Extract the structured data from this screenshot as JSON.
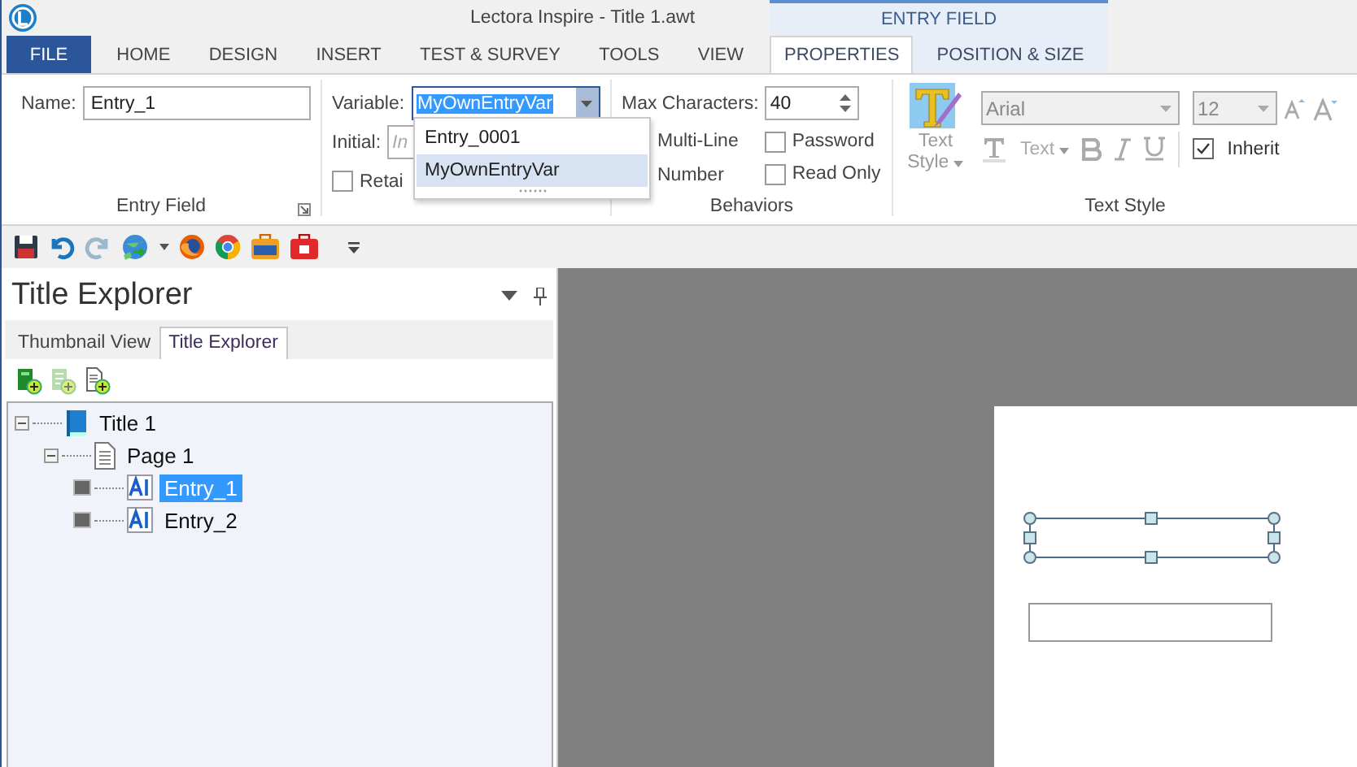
{
  "window": {
    "title": "Lectora Inspire - Title 1.awt",
    "context_group": "ENTRY FIELD"
  },
  "tabs": [
    {
      "label": "FILE",
      "kind": "file",
      "selected": false
    },
    {
      "label": "HOME",
      "kind": "normal",
      "selected": false
    },
    {
      "label": "DESIGN",
      "kind": "normal",
      "selected": false
    },
    {
      "label": "INSERT",
      "kind": "normal",
      "selected": false
    },
    {
      "label": "TEST & SURVEY",
      "kind": "normal",
      "selected": false
    },
    {
      "label": "TOOLS",
      "kind": "normal",
      "selected": false
    },
    {
      "label": "VIEW",
      "kind": "normal",
      "selected": false
    },
    {
      "label": "PROPERTIES",
      "kind": "context",
      "selected": true
    },
    {
      "label": "POSITION & SIZE",
      "kind": "context",
      "selected": false
    }
  ],
  "entry_field_group": {
    "name_label": "Name:",
    "name_value": "Entry_1",
    "group_label": "Entry Field"
  },
  "value_group": {
    "variable_label": "Variable:",
    "variable_value": "MyOwnEntryVar",
    "initial_label": "Initial:",
    "initial_placeholder": "In",
    "retain": {
      "label": "Retai",
      "checked": false
    },
    "variable_options": [
      {
        "label": "Entry_0001",
        "selected": false
      },
      {
        "label": "MyOwnEntryVar",
        "selected": true
      }
    ]
  },
  "behaviors_group": {
    "max_label": "Max Characters:",
    "max_value": "40",
    "multi_line_label": "Multi-Line",
    "number_label": "Number",
    "group_label": "Behaviors",
    "checkboxes": [
      {
        "label": "Password",
        "checked": false
      },
      {
        "label": "Read Only",
        "checked": false
      }
    ]
  },
  "text_style_group": {
    "style_button": "Text Style",
    "font": "Arial",
    "size": "12",
    "text_button": "Text",
    "inherit": {
      "label": "Inherit",
      "checked": true
    },
    "group_label": "Text Style"
  },
  "title_explorer": {
    "title": "Title Explorer",
    "tabs": [
      {
        "label": "Thumbnail View",
        "selected": false
      },
      {
        "label": "Title Explorer",
        "selected": true
      }
    ],
    "tree": [
      {
        "label": "Title 1",
        "kind": "title",
        "expanded": true,
        "selected": false,
        "children": [
          {
            "label": "Page 1",
            "kind": "page",
            "expanded": true,
            "selected": false,
            "children": [
              {
                "label": "Entry_1",
                "kind": "entry",
                "selected": true
              },
              {
                "label": "Entry_2",
                "kind": "entry",
                "selected": false
              }
            ]
          }
        ]
      }
    ]
  }
}
